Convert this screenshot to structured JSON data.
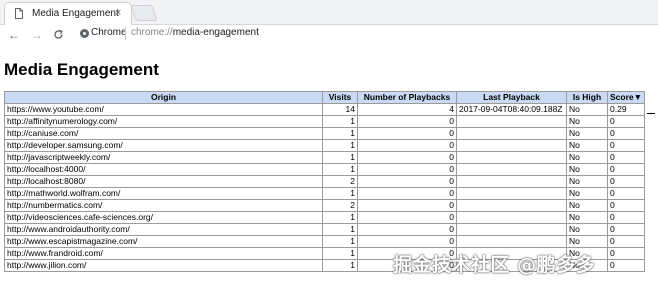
{
  "browser": {
    "tab_title": "Media Engagement",
    "tab_close": "×",
    "back": "←",
    "forward": "→",
    "reload": "C",
    "chip_label": "Chrome",
    "url_scheme": "chrome://",
    "url_host": "media-engagement"
  },
  "page": {
    "title": "Media Engagement"
  },
  "table": {
    "headers": [
      "Origin",
      "Visits",
      "Number of Playbacks",
      "Last Playback",
      "Is High",
      "Score▼"
    ],
    "rows": [
      [
        "https://www.youtube.com/",
        "14",
        "4",
        "2017-09-04T08:40:09.188Z",
        "No",
        "0.29"
      ],
      [
        "http://affinitynumerology.com/",
        "1",
        "0",
        "",
        "No",
        "0"
      ],
      [
        "http://caniuse.com/",
        "1",
        "0",
        "",
        "No",
        "0"
      ],
      [
        "http://developer.samsung.com/",
        "1",
        "0",
        "",
        "No",
        "0"
      ],
      [
        "http://javascriptweekly.com/",
        "1",
        "0",
        "",
        "No",
        "0"
      ],
      [
        "http://localhost:4000/",
        "1",
        "0",
        "",
        "No",
        "0"
      ],
      [
        "http://localhost:8080/",
        "2",
        "0",
        "",
        "No",
        "0"
      ],
      [
        "http://mathworld.wolfram.com/",
        "1",
        "0",
        "",
        "No",
        "0"
      ],
      [
        "http://numbermatics.com/",
        "2",
        "0",
        "",
        "No",
        "0"
      ],
      [
        "http://videosciences.cafe-sciences.org/",
        "1",
        "0",
        "",
        "No",
        "0"
      ],
      [
        "http://www.androidauthority.com/",
        "1",
        "0",
        "",
        "No",
        "0"
      ],
      [
        "http://www.escapistmagazine.com/",
        "1",
        "0",
        "",
        "No",
        "0"
      ],
      [
        "http://www.frandroid.com/",
        "1",
        "0",
        "",
        "No",
        "0"
      ],
      [
        "http://www.jilion.com/",
        "1",
        "0",
        "",
        "No",
        "0"
      ]
    ]
  },
  "watermark": "掘金技术社区 @鹏多多"
}
